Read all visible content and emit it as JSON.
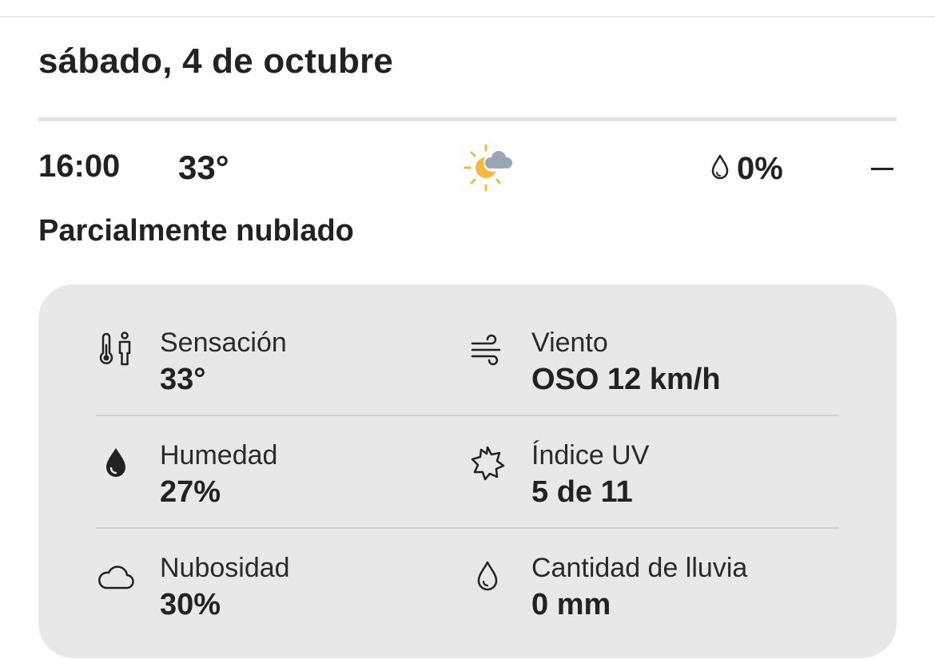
{
  "date_heading": "sábado, 4 de octubre",
  "hour": {
    "time": "16:00",
    "temperature": "33°",
    "condition_icon": "partly-cloudy-icon",
    "precipitation_icon": "raindrop-icon",
    "precipitation_chance": "0%",
    "collapse_icon": "collapse-dash-icon"
  },
  "condition": "Parcialmente nublado",
  "details": {
    "feels_like": {
      "icon": "thermometer-person-icon",
      "label": "Sensación",
      "value": "33°"
    },
    "wind": {
      "icon": "wind-icon",
      "label": "Viento",
      "value": "OSO 12 km/h"
    },
    "humidity": {
      "icon": "humidity-drop-icon",
      "label": "Humedad",
      "value": "27%"
    },
    "uv_index": {
      "icon": "uv-sun-icon",
      "label": "Índice UV",
      "value": "5 de 11"
    },
    "cloud_cover": {
      "icon": "cloud-icon",
      "label": "Nubosidad",
      "value": "30%"
    },
    "rain_amount": {
      "icon": "raindrop-outline-icon",
      "label": "Cantidad de lluvia",
      "value": "0 mm"
    }
  },
  "colors": {
    "card_background": "#e8e8e8",
    "sun": "#f6b93b",
    "cloud": "#9aa6b2",
    "text": "#222222"
  }
}
